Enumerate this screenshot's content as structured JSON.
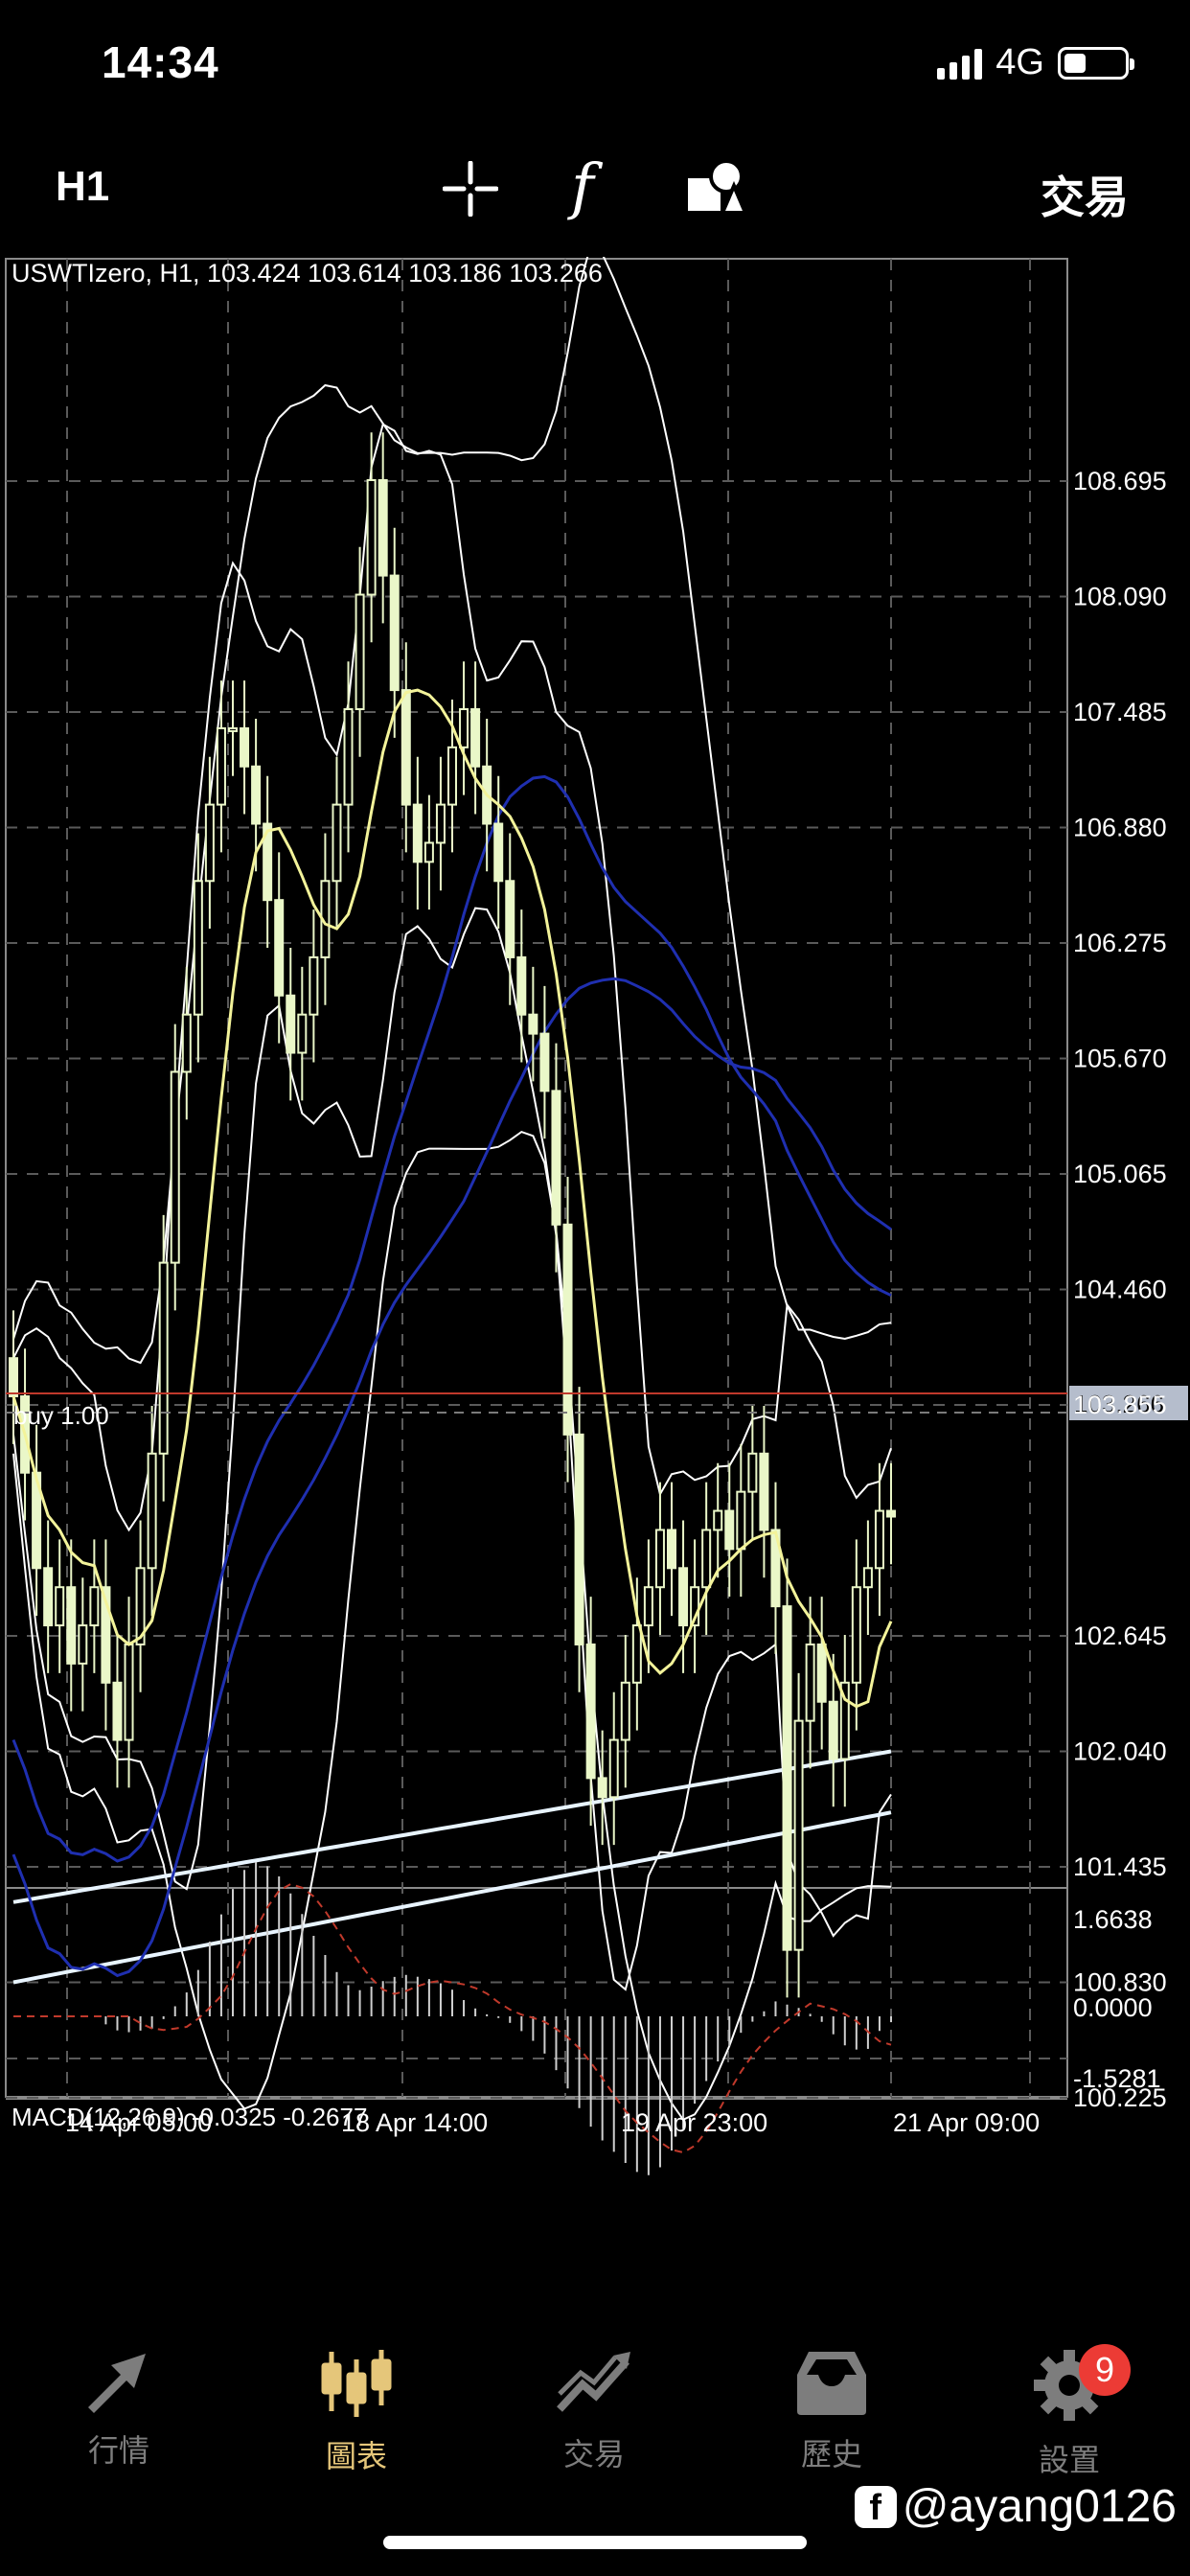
{
  "status_bar": {
    "time": "14:34",
    "network": "4G"
  },
  "toolbar": {
    "timeframe": "H1",
    "indicator_symbol": "f",
    "trade_label": "交易"
  },
  "chart": {
    "header": "USWTIzero, H1, 103.424 103.614 103.186 103.266",
    "price_axis": [
      "108.695",
      "108.090",
      "107.485",
      "106.880",
      "106.275",
      "105.670",
      "105.065",
      "104.460",
      "103.855",
      "102.645",
      "102.040",
      "101.435",
      "100.830",
      "100.225"
    ],
    "current_price": "103.266",
    "position_label": "buy 1.00",
    "macd_label": "MACD(12,26,9) -0.0325 -0.2677",
    "macd_axis": [
      "1.6638",
      "0.0000",
      "-1.5281"
    ],
    "time_axis": [
      "14 Apr 05:00",
      "18 Apr 14:00",
      "19 Apr 23:00",
      "21 Apr 09:00"
    ],
    "colors": {
      "price_line": "#c0392b",
      "price_tag": "#b5bdcc",
      "ma_fast": "#f3f39a",
      "ma_slow": "#1f2fb0",
      "bands": "#ffffff",
      "long_ma": "#e8f4ff",
      "candles": "#eaf7c8"
    }
  },
  "chart_data": {
    "type": "candlestick",
    "symbol": "USWTIzero",
    "timeframe": "H1",
    "ylim": [
      99.9,
      109.0
    ],
    "closes": [
      103.9,
      103.5,
      103.0,
      102.7,
      102.9,
      102.5,
      102.7,
      102.9,
      102.4,
      102.1,
      102.6,
      103.0,
      103.6,
      104.6,
      105.6,
      105.9,
      106.6,
      107.0,
      107.4,
      107.4,
      107.2,
      106.9,
      106.5,
      106.0,
      105.7,
      105.9,
      106.2,
      106.6,
      107.0,
      107.5,
      108.1,
      108.7,
      108.2,
      107.6,
      107.0,
      106.7,
      106.8,
      107.0,
      107.3,
      107.5,
      107.2,
      106.9,
      106.6,
      106.2,
      105.9,
      105.8,
      105.5,
      104.8,
      103.7,
      102.6,
      101.9,
      101.8,
      102.1,
      102.4,
      102.7,
      102.9,
      103.2,
      103.0,
      102.7,
      102.9,
      103.2,
      103.3,
      103.1,
      103.4,
      103.6,
      103.2,
      102.8,
      101.0,
      102.2,
      102.6,
      102.3,
      102.0,
      102.4,
      102.9,
      103.0,
      103.3,
      103.27
    ],
    "macd": {
      "value": -0.0325,
      "signal": -0.2677,
      "axis": [
        1.6638,
        0.0,
        -1.5281
      ]
    },
    "position": {
      "side": "buy",
      "volume": 1.0
    },
    "current_price": 103.266
  },
  "nav": {
    "items": [
      {
        "label": "行情",
        "icon": "arrows-icon",
        "active": false
      },
      {
        "label": "圖表",
        "icon": "candles-icon",
        "active": true
      },
      {
        "label": "交易",
        "icon": "trend-icon",
        "active": false
      },
      {
        "label": "歷史",
        "icon": "inbox-icon",
        "active": false
      },
      {
        "label": "設置",
        "icon": "gear-icon",
        "active": false,
        "badge": "9"
      }
    ]
  },
  "watermark": "@ayang0126"
}
